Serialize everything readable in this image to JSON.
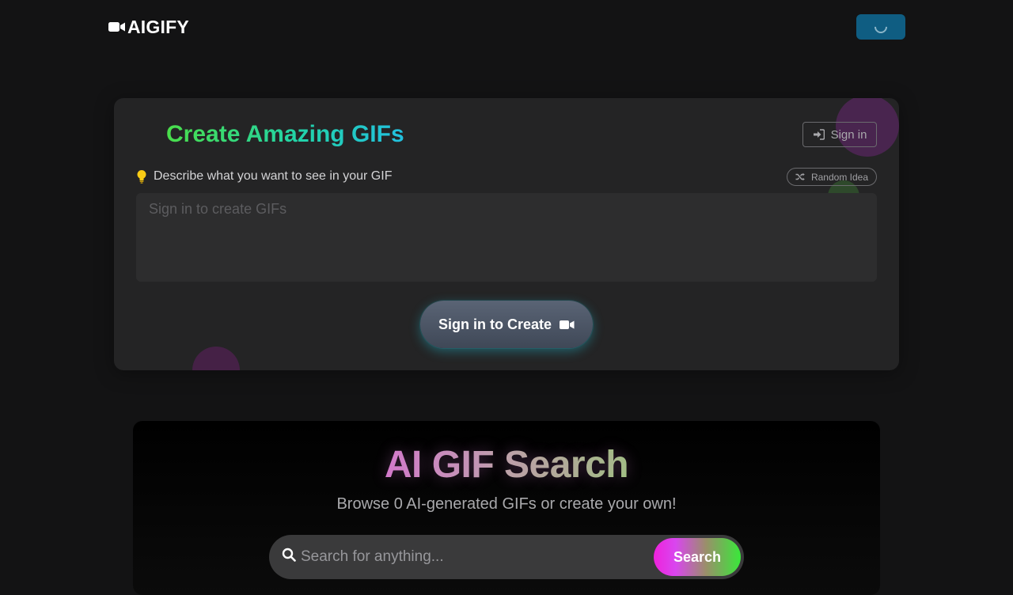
{
  "header": {
    "brand": "AIGIFY",
    "logo_icon": "video-camera-icon",
    "loading_icon": "spinner-icon"
  },
  "create_panel": {
    "title": "Create Amazing GIFs",
    "sign_in_label": "Sign in",
    "sign_in_icon": "sign-in-icon",
    "prompt_label": "Describe what you want to see in your GIF",
    "prompt_icon": "lightbulb-icon",
    "random_idea_label": "Random Idea",
    "random_idea_icon": "shuffle-icon",
    "prompt_placeholder": "Sign in to create GIFs",
    "prompt_value": "",
    "create_button_label": "Sign in to Create",
    "create_button_icon": "video-camera-icon"
  },
  "search_panel": {
    "title": "AI GIF Search",
    "subtitle": "Browse 0 AI-generated GIFs or create your own!",
    "search_placeholder": "Search for anything...",
    "search_value": "",
    "search_icon": "search-icon",
    "search_button_label": "Search"
  },
  "colors": {
    "background": "#131314",
    "card": "#242425",
    "accent_blue": "#0f5d82",
    "title_gradient_start": "#4ade4a",
    "title_gradient_end": "#22c0e0",
    "search_button_start": "#ee22dc",
    "search_button_end": "#39e83a"
  }
}
